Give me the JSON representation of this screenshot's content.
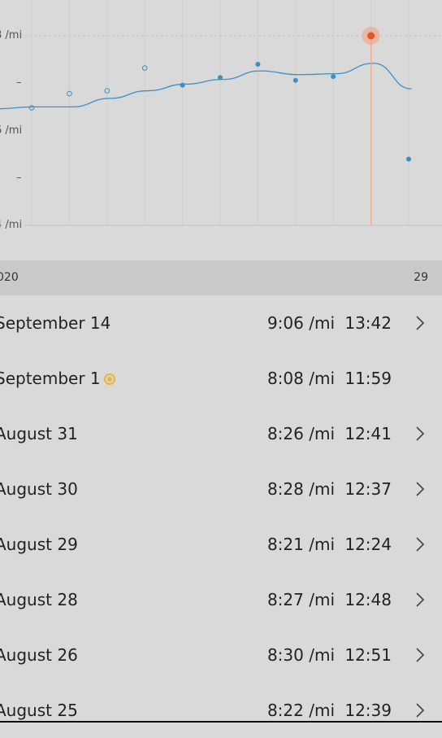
{
  "chart_data": {
    "type": "scatter",
    "y_ticks": [
      {
        "label": "8 /mi",
        "value": 8
      },
      {
        "label": "",
        "value": 8.5
      },
      {
        "label": "6 /mi",
        "value": 9
      },
      {
        "label": "",
        "value": 9.5
      },
      {
        "label": "4 /mi",
        "value": 10
      }
    ],
    "start_label": "020",
    "end_label": "29",
    "points": [
      {
        "value": 8.76,
        "filled": false
      },
      {
        "value": 8.61,
        "filled": false
      },
      {
        "value": 8.58,
        "filled": false
      },
      {
        "value": 8.34,
        "filled": false
      },
      {
        "value": 8.52,
        "filled": true
      },
      {
        "value": 8.44,
        "filled": true
      },
      {
        "value": 8.3,
        "filled": true
      },
      {
        "value": 8.47,
        "filled": true
      },
      {
        "value": 8.43,
        "filled": true
      },
      {
        "value": 8.0,
        "filled": true,
        "selected": true
      },
      {
        "value": 9.3,
        "filled": true
      }
    ],
    "trend": [
      8.77,
      8.75,
      8.75,
      8.66,
      8.58,
      8.51,
      8.46,
      8.37,
      8.41,
      8.4,
      8.29,
      8.56
    ],
    "colors": {
      "line": "#3d8fc4",
      "selected": "#e0562b",
      "selected_halo": "#f0a88c",
      "grid": "#c8c8c8"
    }
  },
  "date_bar": {
    "start": "020",
    "end": "29"
  },
  "runs": [
    {
      "date": "September 14",
      "pace": "9:06 /mi",
      "time": "13:42",
      "chevron": true,
      "badge": false
    },
    {
      "date": "September 1",
      "pace": "8:08 /mi",
      "time": "11:59",
      "chevron": false,
      "badge": true
    },
    {
      "date": "August 31",
      "pace": "8:26 /mi",
      "time": "12:41",
      "chevron": true,
      "badge": false
    },
    {
      "date": "August 30",
      "pace": "8:28 /mi",
      "time": "12:37",
      "chevron": true,
      "badge": false
    },
    {
      "date": "August 29",
      "pace": "8:21 /mi",
      "time": "12:24",
      "chevron": true,
      "badge": false
    },
    {
      "date": "August 28",
      "pace": "8:27 /mi",
      "time": "12:48",
      "chevron": true,
      "badge": false
    },
    {
      "date": "August 26",
      "pace": "8:30 /mi",
      "time": "12:51",
      "chevron": true,
      "badge": false
    },
    {
      "date": "August 25",
      "pace": "8:22 /mi",
      "time": "12:39",
      "chevron": true,
      "badge": false
    }
  ]
}
